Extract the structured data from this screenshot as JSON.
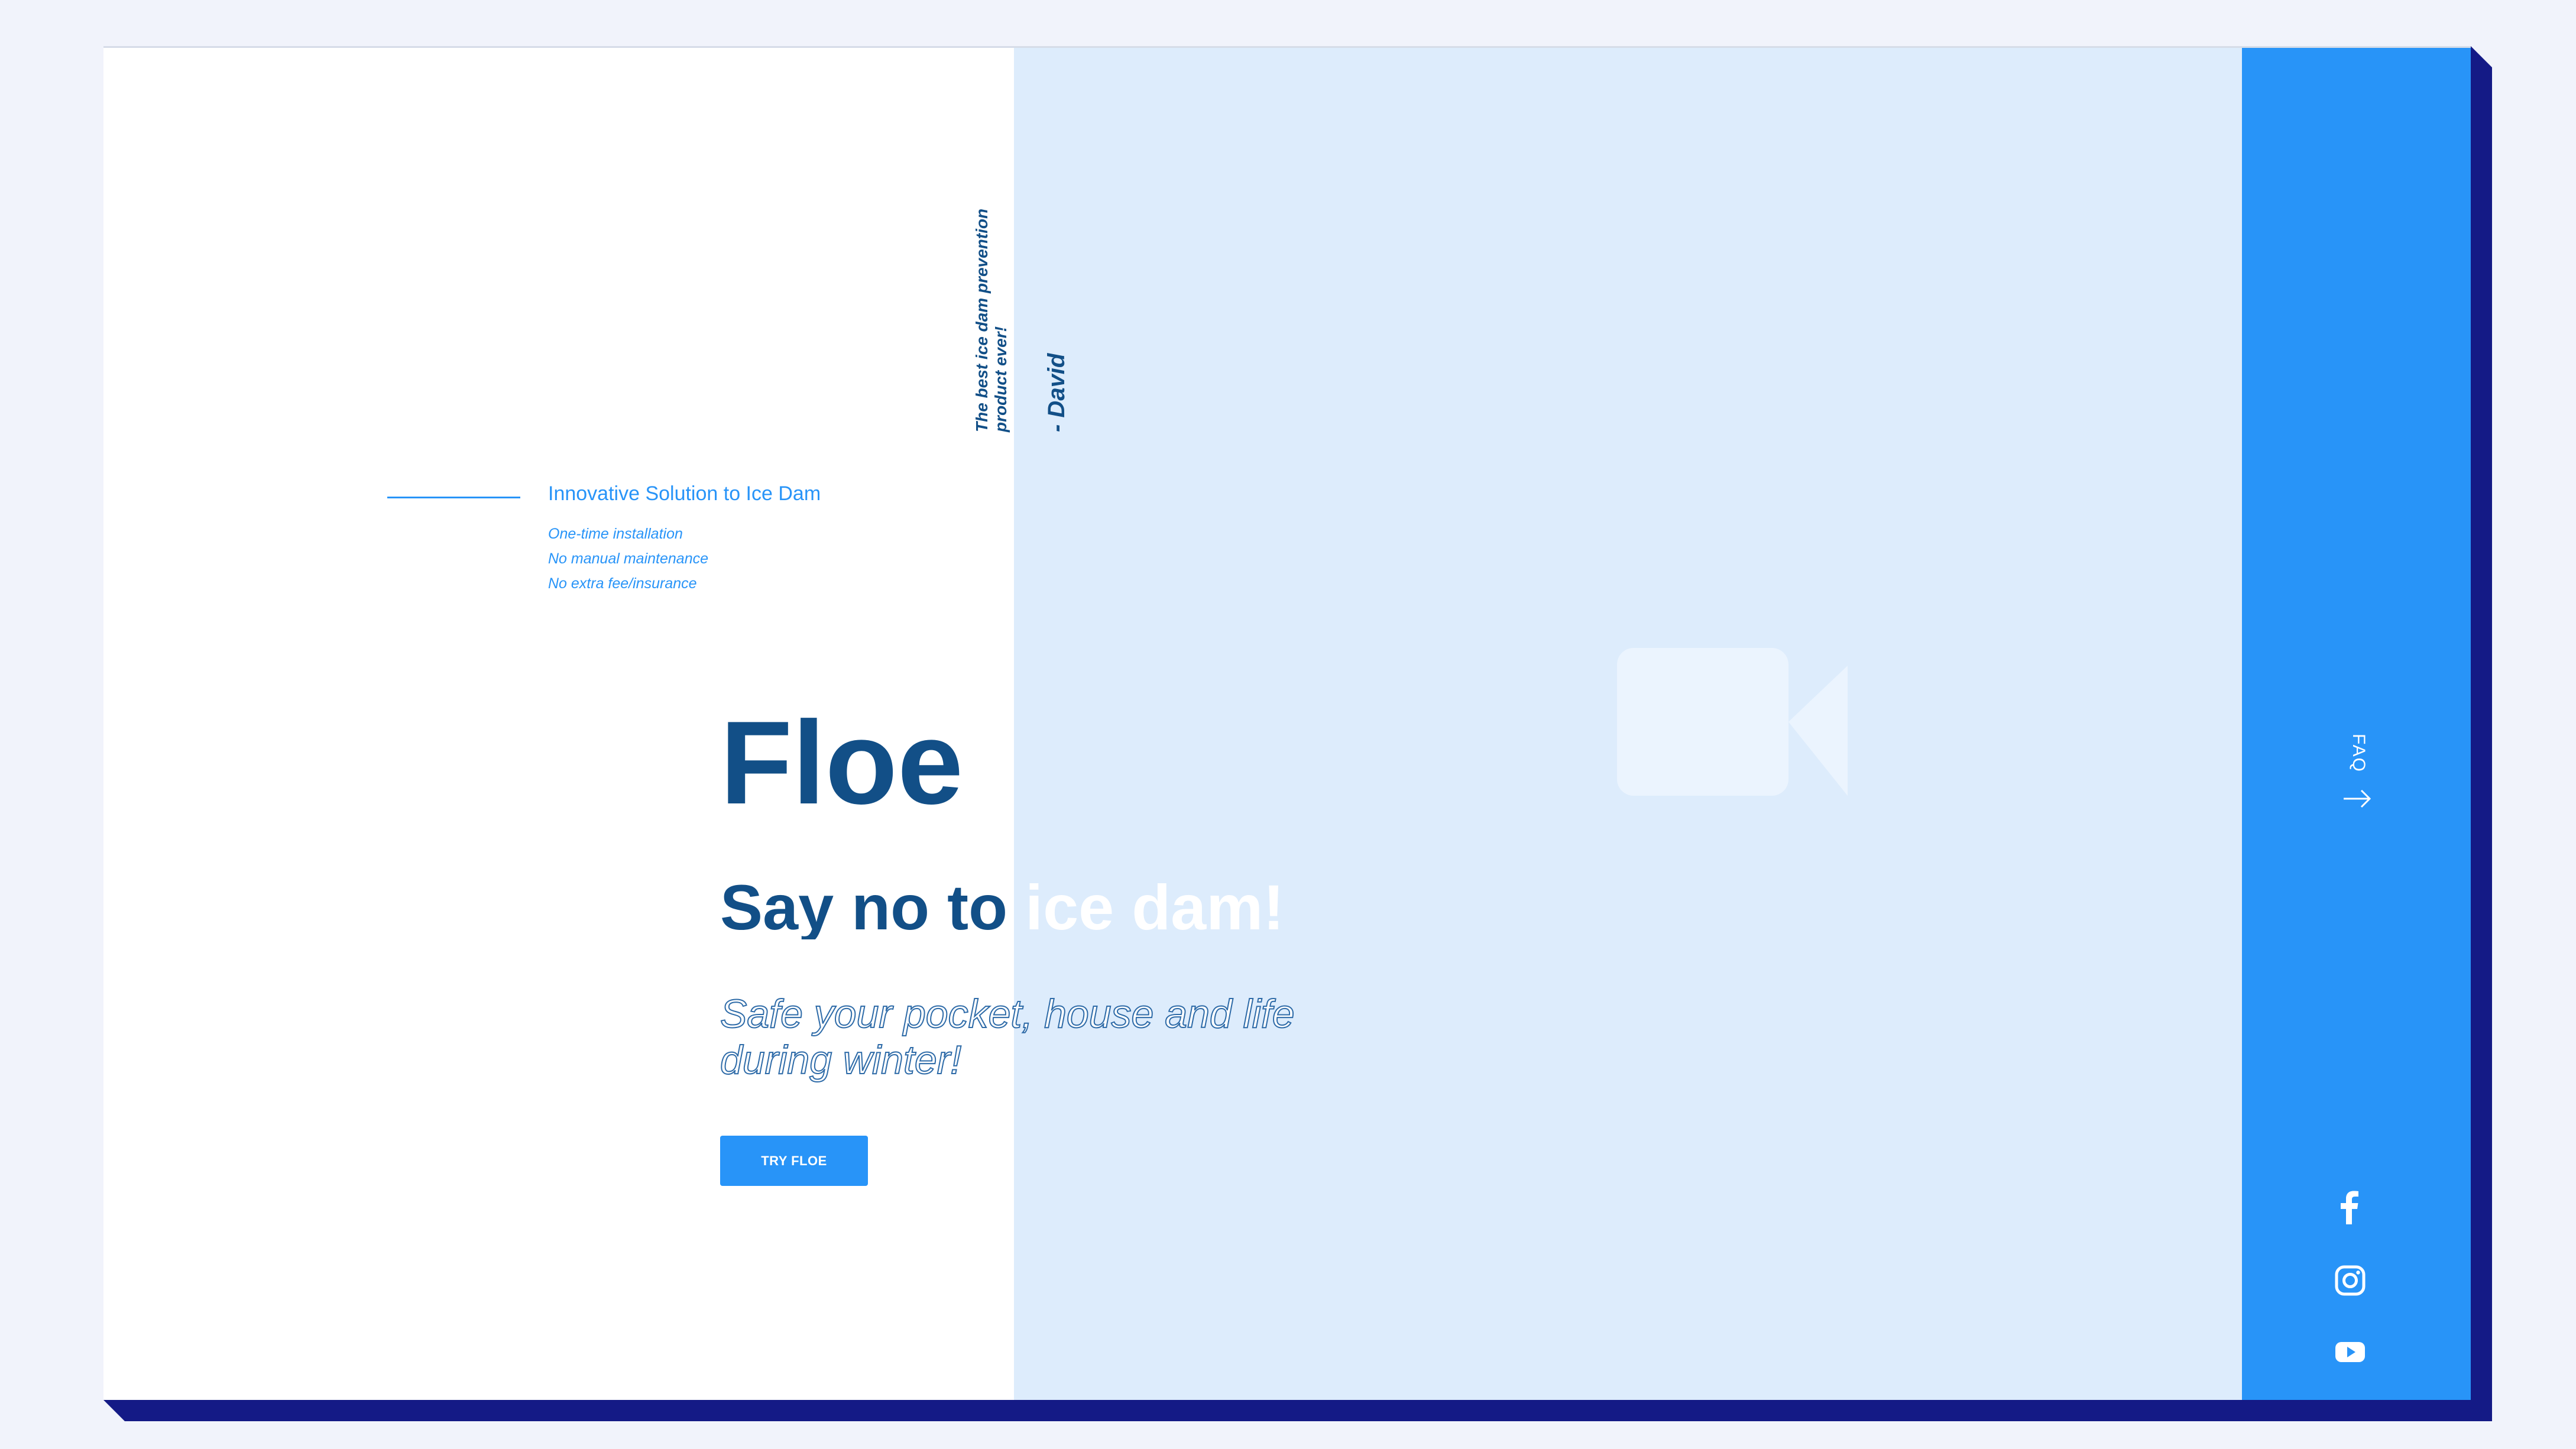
{
  "testimonial": {
    "quote": "The best ice dam prevention product ever!",
    "author": "- David"
  },
  "features": {
    "title": "Innovative Solution to Ice Dam",
    "items": [
      "One-time installation",
      "No manual maintenance",
      "No extra fee/insurance"
    ]
  },
  "hero": {
    "title": "Floe",
    "subtitle": "Say no to ice dam!",
    "tagline": "Safe your pocket, house and life during winter!",
    "cta_label": "TRY FLOE"
  },
  "sidebar": {
    "faq_label": "FAQ",
    "social_icons": [
      "facebook-icon",
      "instagram-icon",
      "youtube-icon"
    ]
  },
  "video": {
    "icon": "video-camera-icon"
  },
  "colors": {
    "accent": "#2894f8",
    "dark_blue": "#124f87",
    "navy_shadow": "#141a86",
    "video_bg": "#ddecfc",
    "page_bg": "#f1f3fb"
  }
}
